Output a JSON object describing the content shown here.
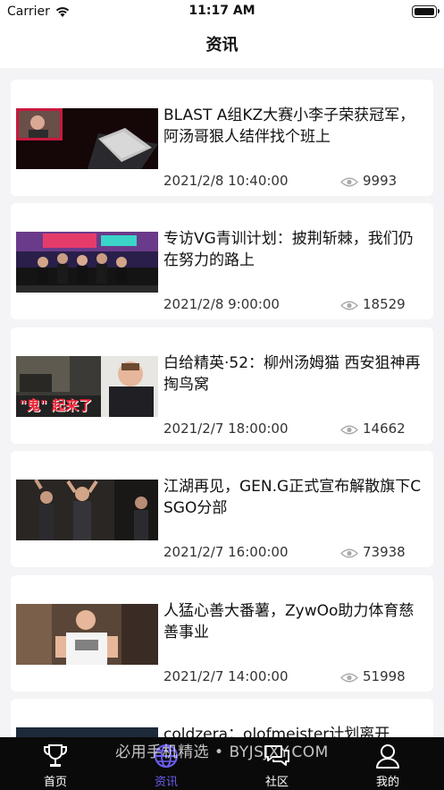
{
  "status_bar": {
    "carrier": "Carrier",
    "time": "11:17 AM"
  },
  "nav": {
    "title": "资讯"
  },
  "articles": [
    {
      "title": "BLAST A组KZ大赛小李子荣获冠军，阿汤哥狠人结伴找个班上",
      "date": "2021/2/8 10:40:00",
      "views": "9993"
    },
    {
      "title": "专访VG青训计划：披荆斩棘，我们仍在努力的路上",
      "date": "2021/2/8 9:00:00",
      "views": "18529"
    },
    {
      "title": "白给精英·52：柳州汤姆猫 西安狙神再掏鸟窝",
      "date": "2021/2/7 18:00:00",
      "views": "14662",
      "thumb_caption": "\"鬼\" 起来了"
    },
    {
      "title": "江湖再见，GEN.G正式宣布解散旗下CSGO分部",
      "date": "2021/2/7 16:00:00",
      "views": "73938"
    },
    {
      "title": "人猛心善大番薯，ZywOo助力体育慈善事业",
      "date": "2021/2/7 14:00:00",
      "views": "51998"
    },
    {
      "title": "coldzera：olofmeister计划离开",
      "date": "",
      "views": ""
    }
  ],
  "tabs": [
    {
      "label": "首页",
      "icon": "trophy-icon"
    },
    {
      "label": "资讯",
      "icon": "globe-icon",
      "active": true
    },
    {
      "label": "社区",
      "icon": "chat-icon"
    },
    {
      "label": "我的",
      "icon": "person-icon"
    }
  ],
  "watermark": "必用手机精选 • BYJSJXY.COM",
  "colors": {
    "accent": "#6b5ef0",
    "tab_bar": "#0a0a0a",
    "background": "#f4f4f6"
  }
}
